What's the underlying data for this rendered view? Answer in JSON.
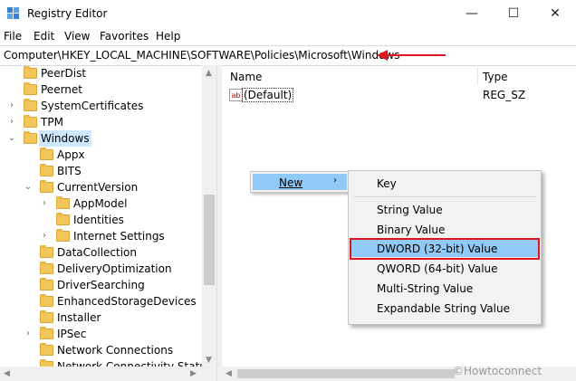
{
  "window": {
    "title": "Registry Editor",
    "minimize_glyph": "—",
    "maximize_glyph": "☐",
    "close_glyph": "✕"
  },
  "menu": [
    "File",
    "Edit",
    "View",
    "Favorites",
    "Help"
  ],
  "address": "Computer\\HKEY_LOCAL_MACHINE\\SOFTWARE\\Policies\\Microsoft\\Windows",
  "tree": [
    {
      "label": "PeerDist",
      "depth": 1,
      "chevron": ""
    },
    {
      "label": "Peernet",
      "depth": 1,
      "chevron": ""
    },
    {
      "label": "SystemCertificates",
      "depth": 1,
      "chevron": ">"
    },
    {
      "label": "TPM",
      "depth": 1,
      "chevron": ">"
    },
    {
      "label": "Windows",
      "depth": 1,
      "chevron": "v",
      "selected": true
    },
    {
      "label": "Appx",
      "depth": 2,
      "chevron": ""
    },
    {
      "label": "BITS",
      "depth": 2,
      "chevron": ""
    },
    {
      "label": "CurrentVersion",
      "depth": 2,
      "chevron": "v"
    },
    {
      "label": "AppModel",
      "depth": 3,
      "chevron": ">"
    },
    {
      "label": "Identities",
      "depth": 3,
      "chevron": ""
    },
    {
      "label": "Internet Settings",
      "depth": 3,
      "chevron": ">"
    },
    {
      "label": "DataCollection",
      "depth": 2,
      "chevron": ""
    },
    {
      "label": "DeliveryOptimization",
      "depth": 2,
      "chevron": ""
    },
    {
      "label": "DriverSearching",
      "depth": 2,
      "chevron": ""
    },
    {
      "label": "EnhancedStorageDevices",
      "depth": 2,
      "chevron": ""
    },
    {
      "label": "Installer",
      "depth": 2,
      "chevron": ""
    },
    {
      "label": "IPSec",
      "depth": 2,
      "chevron": ">"
    },
    {
      "label": "Network Connections",
      "depth": 2,
      "chevron": ""
    },
    {
      "label": "Network Connectivity Status Indicator",
      "depth": 2,
      "chevron": ""
    }
  ],
  "list": {
    "col_name": "Name",
    "col_type": "Type",
    "rows": [
      {
        "name": "(Default)",
        "type": "REG_SZ",
        "icon": "ab"
      }
    ]
  },
  "context_menu": {
    "new_label": "New",
    "arrow": "›",
    "submenu": [
      "Key",
      "String Value",
      "Binary Value",
      "DWORD (32-bit) Value",
      "QWORD (64-bit) Value",
      "Multi-String Value",
      "Expandable String Value"
    ],
    "highlighted": "DWORD (32-bit) Value"
  },
  "colors": {
    "annotation_red": "#e0141e",
    "highlight_blue": "#91c9f7"
  },
  "watermark": "©Howtoconnect"
}
